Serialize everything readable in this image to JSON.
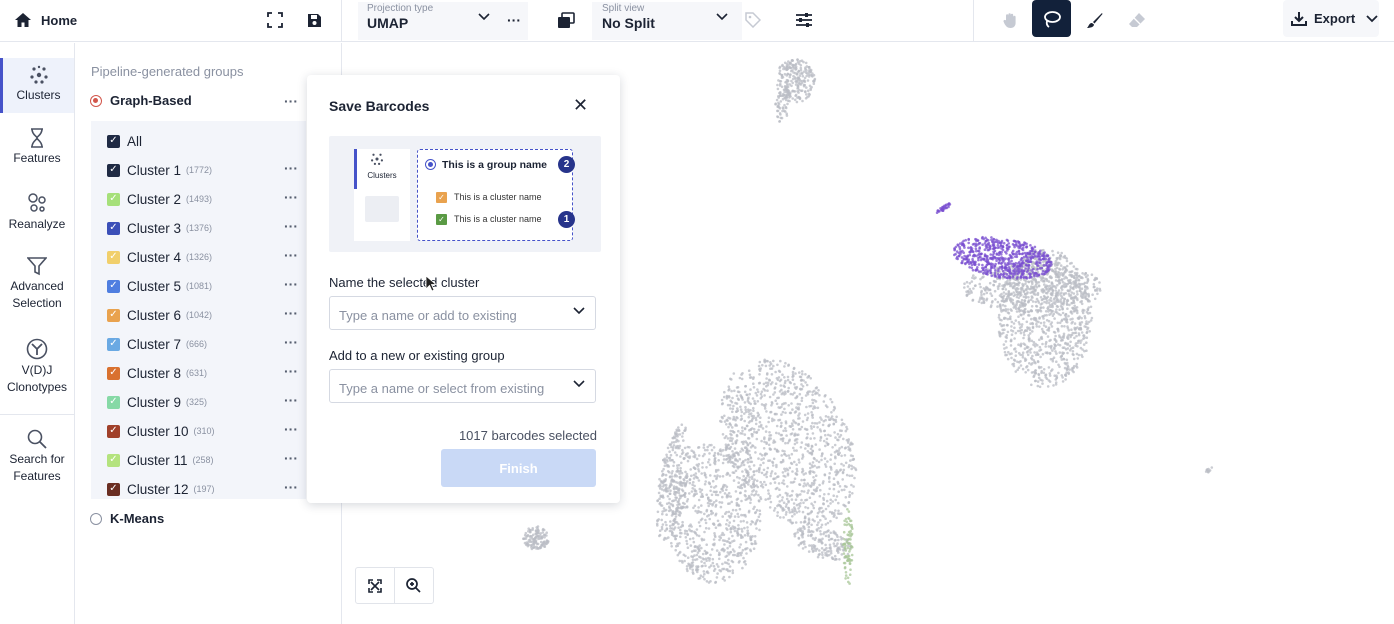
{
  "topbar": {
    "home_label": "Home",
    "projection": {
      "caption": "Projection type",
      "value": "UMAP"
    },
    "split": {
      "caption": "Split view",
      "value": "No Split"
    },
    "export_label": "Export",
    "active_tool": "lasso"
  },
  "leftnav": {
    "items": [
      {
        "label": "Clusters",
        "icon": "clusters-icon",
        "active": true
      },
      {
        "label": "Features",
        "icon": "hourglass-icon",
        "active": false
      },
      {
        "label": "Reanalyze",
        "icon": "reanalyze-icon",
        "active": false
      },
      {
        "label_line1": "Advanced",
        "label_line2": "Selection",
        "icon": "filter-icon",
        "active": false
      },
      {
        "label_line1": "V(D)J",
        "label_line2": "Clonotypes",
        "icon": "vdj-icon",
        "active": false
      },
      {
        "label_line1": "Search for",
        "label_line2": "Features",
        "icon": "search-icon",
        "active": false
      }
    ]
  },
  "panel": {
    "heading": "Pipeline-generated groups",
    "group_selected": "Graph-Based",
    "group_other": "K-Means",
    "all_label": "All",
    "clusters": [
      {
        "name": "Cluster 1",
        "count": "(1772)",
        "color": "#1f2a44"
      },
      {
        "name": "Cluster 2",
        "count": "(1493)",
        "color": "#a6e07a"
      },
      {
        "name": "Cluster 3",
        "count": "(1376)",
        "color": "#3b4fb8"
      },
      {
        "name": "Cluster 4",
        "count": "(1326)",
        "color": "#f1cf6b"
      },
      {
        "name": "Cluster 5",
        "count": "(1081)",
        "color": "#4f7ee0"
      },
      {
        "name": "Cluster 6",
        "count": "(1042)",
        "color": "#e9a24e"
      },
      {
        "name": "Cluster 7",
        "count": "(666)",
        "color": "#6aa9e3"
      },
      {
        "name": "Cluster 8",
        "count": "(631)",
        "color": "#d9712f"
      },
      {
        "name": "Cluster 9",
        "count": "(325)",
        "color": "#86d9a6"
      },
      {
        "name": "Cluster 10",
        "count": "(310)",
        "color": "#a0402a"
      },
      {
        "name": "Cluster 11",
        "count": "(258)",
        "color": "#b4e37e"
      },
      {
        "name": "Cluster 12",
        "count": "(197)",
        "color": "#6a2e22"
      }
    ]
  },
  "modal": {
    "title": "Save Barcodes",
    "illustration": {
      "nav_label": "Clusters",
      "group_name": "This is a group name",
      "cluster_name_1": "This is a cluster name",
      "cluster_name_2": "This is a cluster name",
      "badge_group": "2",
      "badge_cluster": "1"
    },
    "name_label": "Name the selected cluster",
    "name_placeholder": "Type a name or add to existing",
    "group_label": "Add to a new or existing group",
    "group_placeholder": "Type a name or select from existing",
    "selected_count": "1017 barcodes selected",
    "finish_label": "Finish"
  },
  "colors": {
    "selection": "#7a4fd0",
    "points": "#b9bcc4",
    "accent": "#4653c9"
  }
}
